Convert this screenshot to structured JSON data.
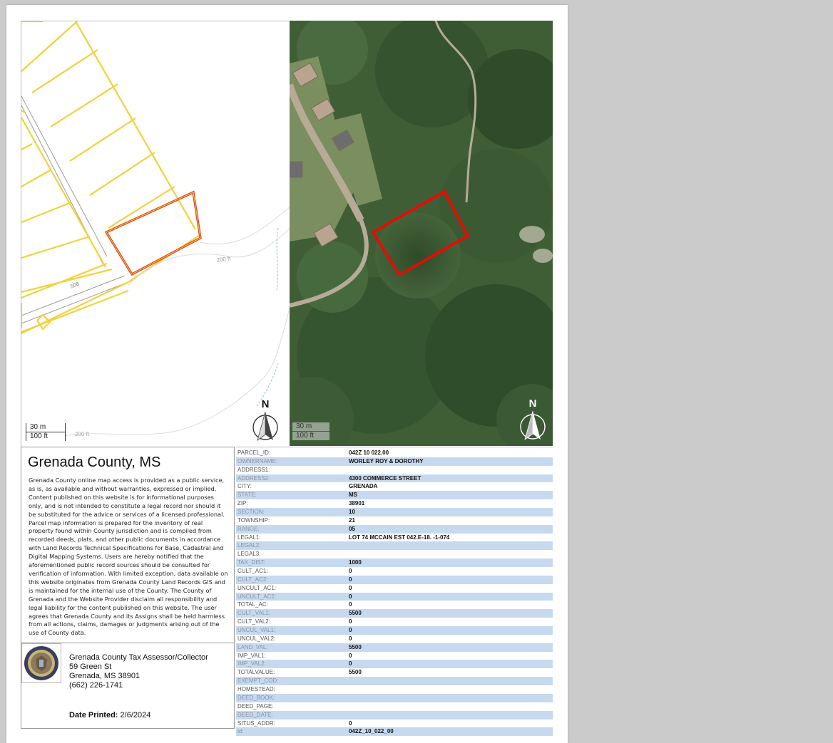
{
  "left_map": {
    "labels": {
      "parcel_number": "508",
      "contour_a": "200 ft",
      "contour_b": "200 ft"
    },
    "scale": {
      "metric": "30 m",
      "imperial": "100 ft"
    },
    "north_label": "N"
  },
  "right_map": {
    "scale": {
      "metric": "30 m",
      "imperial": "100 ft"
    },
    "north_label": "N"
  },
  "info": {
    "title": "Grenada County, MS",
    "disclaimer": "Grenada County online map access is provided as a public service, as is, as available and without warranties, expressed or implied. Content published on this website is for informational purposes only, and is not intended to constitute a legal record nor should it be substituted for the advice or services of a licensed professional. Parcel map information is prepared for the inventory of real property found within County jurisdiction and is compiled from recorded deeds, plats, and other public documents in accordance with Land Records Technical Specifications for Base, Cadastral and Digital Mapping Systems. Users are hereby notified that the aforementioned public record sources should be consulted for verification of information. With limited exception, data available on this website originates from Grenada County Land Records GIS and is maintained for the internal use of the County. The County of Grenada and the Website Provider disclaim all responsibility and legal liability for the content published on this website. The user agrees that Grenada County and its Assigns shall be held harmless from all actions, claims, damages or judgments arising out of the use of County data.",
    "office": {
      "name": "Grenada County Tax Assessor/Collector",
      "street": "59 Green St",
      "city": "Grenada, MS 38901",
      "phone": "(662) 226-1741"
    },
    "date_label": "Date Printed:",
    "date_value": "2/6/2024"
  },
  "attributes": [
    {
      "key": "PARCEL_ID:",
      "value": "042Z 10 022.00"
    },
    {
      "key": "OWNERNAME:",
      "value": "WORLEY ROY & DOROTHY"
    },
    {
      "key": "ADDRESS1:",
      "value": ""
    },
    {
      "key": "ADDRESS2:",
      "value": "4300 COMMERCE STREET"
    },
    {
      "key": "CITY:",
      "value": "GRENADA"
    },
    {
      "key": "STATE:",
      "value": "MS"
    },
    {
      "key": "ZIP:",
      "value": "38901"
    },
    {
      "key": "SECTION:",
      "value": "10"
    },
    {
      "key": "TOWNSHIP:",
      "value": "21"
    },
    {
      "key": "RANGE:",
      "value": "05"
    },
    {
      "key": "LEGAL1:",
      "value": "LOT 74 MCCAIN EST 042.E-18. -1-074"
    },
    {
      "key": "LEGAL2:",
      "value": ""
    },
    {
      "key": "LEGAL3:",
      "value": ""
    },
    {
      "key": "TAX_DIST:",
      "value": "1000"
    },
    {
      "key": "CULT_AC1:",
      "value": "0"
    },
    {
      "key": "CULT_AC2:",
      "value": "0"
    },
    {
      "key": "UNCULT_AC1:",
      "value": "0"
    },
    {
      "key": "UNCULT_AC2:",
      "value": "0"
    },
    {
      "key": "TOTAL_AC:",
      "value": "0"
    },
    {
      "key": "CULT_VAL1:",
      "value": "5500"
    },
    {
      "key": "CULT_VAL2:",
      "value": "0"
    },
    {
      "key": "UNCUL_VAL1:",
      "value": "0"
    },
    {
      "key": "UNCUL_VAL2:",
      "value": "0"
    },
    {
      "key": "LAND_VAL:",
      "value": "5500"
    },
    {
      "key": "IMP_VAL1:",
      "value": "0"
    },
    {
      "key": "IMP_VAL2:",
      "value": "0"
    },
    {
      "key": "TOTALVALUE:",
      "value": "5500"
    },
    {
      "key": "EXEMPT_COD:",
      "value": ""
    },
    {
      "key": "HOMESTEAD:",
      "value": ""
    },
    {
      "key": "DEED_BOOK:",
      "value": ""
    },
    {
      "key": "DEED_PAGE:",
      "value": ""
    },
    {
      "key": "DEED_DATE:",
      "value": ""
    },
    {
      "key": "SITUS_ADDR:",
      "value": "0"
    },
    {
      "key": "id:",
      "value": "042Z_10_022_00"
    }
  ],
  "colors": {
    "parcel_line": "#f2d13a",
    "selected_parcel": "#e23a1f",
    "highlight_red": "#ff0000",
    "table_stripe": "#c6d9ef"
  }
}
